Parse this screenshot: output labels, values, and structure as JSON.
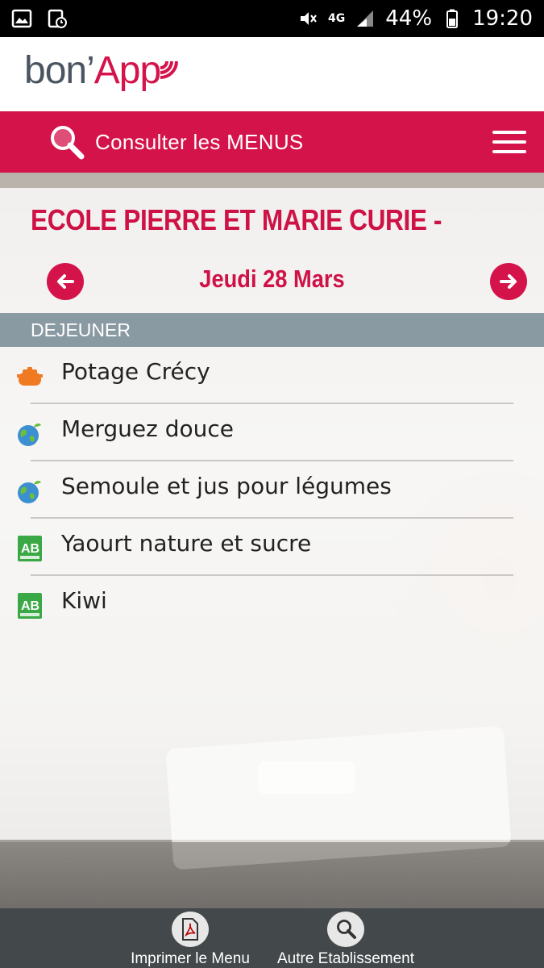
{
  "status_bar": {
    "battery": "44%",
    "time": "19:20",
    "network": "4G",
    "icons": [
      "gallery-icon",
      "alarm-icon",
      "mute-icon",
      "network-icon",
      "signal-icon",
      "battery-icon"
    ]
  },
  "header": {
    "logo_prefix": "bon’",
    "logo_suffix": "App",
    "brand_color": "#d4134a"
  },
  "nav": {
    "search_label": "Consulter les MENUS",
    "icons": [
      "search-icon",
      "hamburger-menu-icon"
    ]
  },
  "page": {
    "school": "ECOLE PIERRE ET MARIE CURIE -",
    "date": "Jeudi 28 Mars",
    "meal": "DEJEUNER"
  },
  "menu_items": [
    {
      "label": "Potage Crécy",
      "icon": "pot-icon"
    },
    {
      "label": "Merguez douce",
      "icon": "local-globe-icon"
    },
    {
      "label": "Semoule et jus pour légumes",
      "icon": "local-globe-icon"
    },
    {
      "label": "Yaourt nature et sucre",
      "icon": "organic-ab-icon"
    },
    {
      "label": "Kiwi",
      "icon": "organic-ab-icon"
    }
  ],
  "bottom_bar": {
    "print_label": "Imprimer le Menu",
    "other_label": "Autre Etablissement"
  },
  "colors": {
    "accent": "#d4134a",
    "meal_bar": "#8a9aa2",
    "bottom_bar": "#43484a"
  }
}
